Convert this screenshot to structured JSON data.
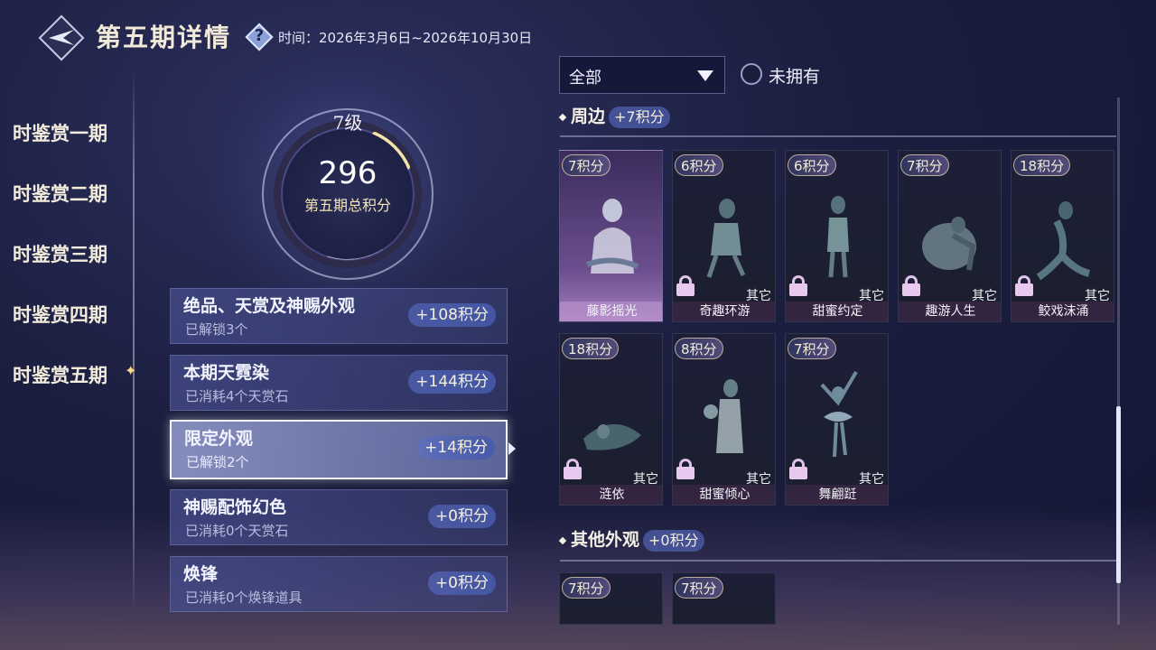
{
  "header": {
    "title": "第五期详情",
    "help": "?",
    "period": "时间：2026年3月6日~2026年10月30日"
  },
  "nav": {
    "items": [
      {
        "label": "时鉴赏一期"
      },
      {
        "label": "时鉴赏二期"
      },
      {
        "label": "时鉴赏三期"
      },
      {
        "label": "时鉴赏四期"
      },
      {
        "label": "时鉴赏五期",
        "active": true
      }
    ]
  },
  "score": {
    "level": "7级",
    "total": "296",
    "label": "第五期总积分"
  },
  "categories": [
    {
      "name": "绝品、天赏及神赐外观",
      "sub": "已解锁3个",
      "points": "+108积分"
    },
    {
      "name": "本期天霓染",
      "sub": "已消耗4个天赏石",
      "points": "+144积分"
    },
    {
      "name": "限定外观",
      "sub": "已解锁2个",
      "points": "+14积分",
      "active": true
    },
    {
      "name": "神赐配饰幻色",
      "sub": "已消耗0个天赏石",
      "points": "+0积分"
    },
    {
      "name": "焕锋",
      "sub": "已消耗0个焕锋道具",
      "points": "+0积分"
    }
  ],
  "filter": {
    "value": "全部",
    "not_owned_label": "未拥有"
  },
  "sections": [
    {
      "title": "周边",
      "points": "+7积分",
      "cards": [
        {
          "points": "7积分",
          "name": "藤影摇光",
          "owned": true
        },
        {
          "points": "6积分",
          "name": "奇趣环游",
          "type": "其它"
        },
        {
          "points": "6积分",
          "name": "甜蜜约定",
          "type": "其它"
        },
        {
          "points": "7积分",
          "name": "趣游人生",
          "type": "其它"
        },
        {
          "points": "18积分",
          "name": "鲛戏沫涌",
          "type": "其它"
        },
        {
          "points": "18积分",
          "name": "涟依",
          "type": "其它"
        },
        {
          "points": "8积分",
          "name": "甜蜜倾心",
          "type": "其它"
        },
        {
          "points": "7积分",
          "name": "舞翩跹",
          "type": "其它"
        }
      ]
    },
    {
      "title": "其他外观",
      "points": "+0积分",
      "cards": [
        {
          "points": "7积分"
        },
        {
          "points": "7积分"
        }
      ]
    }
  ],
  "colors": {
    "accent_gold": "#f3e4b8",
    "card_owned": "#a27fbd",
    "lock": "#e7c9f0"
  }
}
